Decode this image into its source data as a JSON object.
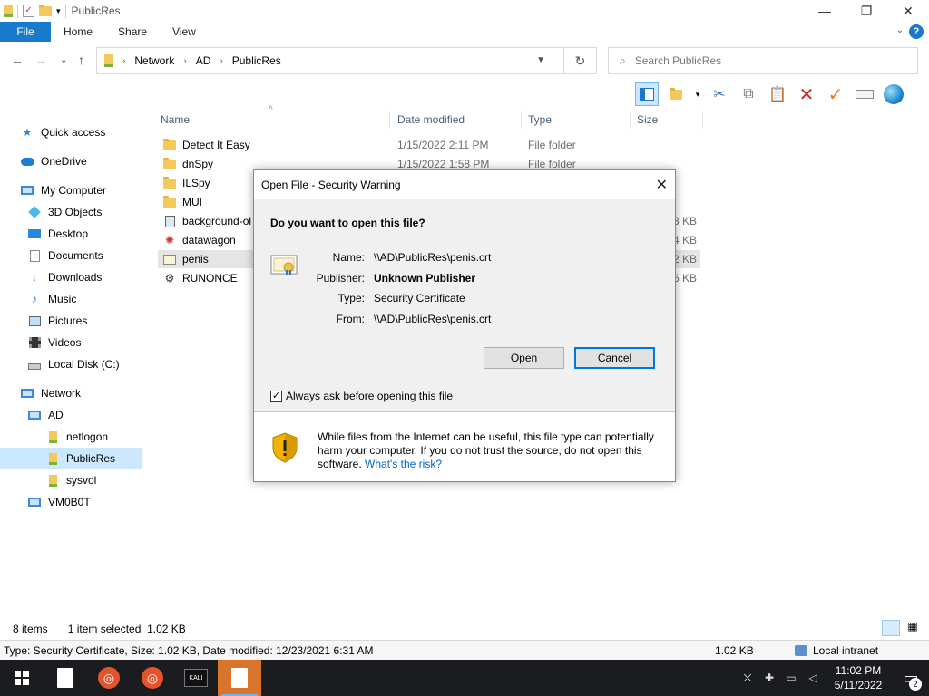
{
  "window": {
    "title": "PublicRes"
  },
  "ribbon": {
    "file": "File",
    "tabs": [
      "Home",
      "Share",
      "View"
    ],
    "help": "?"
  },
  "address": {
    "crumbs": [
      "Network",
      "AD",
      "PublicRes"
    ]
  },
  "search": {
    "placeholder": "Search PublicRes"
  },
  "sidebar": {
    "items": [
      {
        "label": "Quick access",
        "icon": "star-icon",
        "indent": 0,
        "selected": false
      },
      {
        "label": "OneDrive",
        "icon": "cloud-icon",
        "indent": 0,
        "selected": false
      },
      {
        "label": "My Computer",
        "icon": "computer-icon",
        "indent": 0,
        "selected": false
      },
      {
        "label": "3D Objects",
        "icon": "cube-icon",
        "indent": 1,
        "selected": false
      },
      {
        "label": "Desktop",
        "icon": "desktop-icon",
        "indent": 1,
        "selected": false
      },
      {
        "label": "Documents",
        "icon": "documents-icon",
        "indent": 1,
        "selected": false
      },
      {
        "label": "Downloads",
        "icon": "download-icon",
        "indent": 1,
        "selected": false
      },
      {
        "label": "Music",
        "icon": "music-icon",
        "indent": 1,
        "selected": false
      },
      {
        "label": "Pictures",
        "icon": "pictures-icon",
        "indent": 1,
        "selected": false
      },
      {
        "label": "Videos",
        "icon": "videos-icon",
        "indent": 1,
        "selected": false
      },
      {
        "label": "Local Disk (C:)",
        "icon": "disk-icon",
        "indent": 1,
        "selected": false
      },
      {
        "label": "Network",
        "icon": "network-icon",
        "indent": 0,
        "selected": false
      },
      {
        "label": "AD",
        "icon": "computer-icon",
        "indent": 1,
        "selected": false
      },
      {
        "label": "netlogon",
        "icon": "share-folder-icon",
        "indent": 2,
        "selected": false
      },
      {
        "label": "PublicRes",
        "icon": "share-folder-icon",
        "indent": 2,
        "selected": true
      },
      {
        "label": "sysvol",
        "icon": "share-folder-icon",
        "indent": 2,
        "selected": false
      },
      {
        "label": "VM0B0T",
        "icon": "computer-icon",
        "indent": 1,
        "selected": false
      }
    ]
  },
  "columns": {
    "name": "Name",
    "date": "Date modified",
    "type": "Type",
    "size": "Size"
  },
  "files": [
    {
      "name": "Detect It Easy",
      "date": "1/15/2022 2:11 PM",
      "type": "File folder",
      "size": "",
      "icon": "folder-icon",
      "selected": false
    },
    {
      "name": "dnSpy",
      "date": "1/15/2022 1:58 PM",
      "type": "File folder",
      "size": "",
      "icon": "folder-icon",
      "selected": false
    },
    {
      "name": "ILSpy",
      "date": "",
      "type": "",
      "size": "",
      "icon": "folder-icon",
      "selected": false
    },
    {
      "name": "MUI",
      "date": "",
      "type": "",
      "size": "",
      "icon": "folder-icon",
      "selected": false
    },
    {
      "name": "background-ol",
      "date": "",
      "type": "",
      "size": "8 KB",
      "icon": "image-file-icon",
      "selected": false
    },
    {
      "name": "datawagon",
      "date": "",
      "type": "",
      "size": "4 KB",
      "icon": "gear-file-icon",
      "selected": false
    },
    {
      "name": "penis",
      "date": "",
      "type": "",
      "size": "2 KB",
      "icon": "certificate-icon",
      "selected": true
    },
    {
      "name": "RUNONCE",
      "date": "",
      "type": "",
      "size": "6 KB",
      "icon": "script-icon",
      "selected": false
    }
  ],
  "status": {
    "count": "8 items",
    "selected": "1 item selected  1.02 KB"
  },
  "infobar": {
    "details": "Type: Security Certificate, Size: 1.02 KB, Date modified: 12/23/2021 6:31 AM",
    "size": "1.02 KB",
    "zone": "Local intranet"
  },
  "dialog": {
    "title": "Open File - Security Warning",
    "question": "Do you want to open this file?",
    "name_label": "Name:",
    "name_value": "\\\\AD\\PublicRes\\penis.crt",
    "publisher_label": "Publisher:",
    "publisher_value": "Unknown Publisher",
    "type_label": "Type:",
    "type_value": "Security Certificate",
    "from_label": "From:",
    "from_value": "\\\\AD\\PublicRes\\penis.crt",
    "open": "Open",
    "cancel": "Cancel",
    "checkbox": "Always ask before opening this file",
    "checked": true,
    "warning": "While files from the Internet can be useful, this file type can potentially harm your computer. If you do not trust the source, do not open this software.",
    "link": "What's the risk?"
  },
  "taskbar": {
    "kali": "KALI",
    "time": "11:02 PM",
    "date": "5/11/2022",
    "notifications": "2"
  },
  "colors": {
    "accent": "#1979ca",
    "selection": "#cce8ff",
    "taskbar": "#1a1c20"
  }
}
